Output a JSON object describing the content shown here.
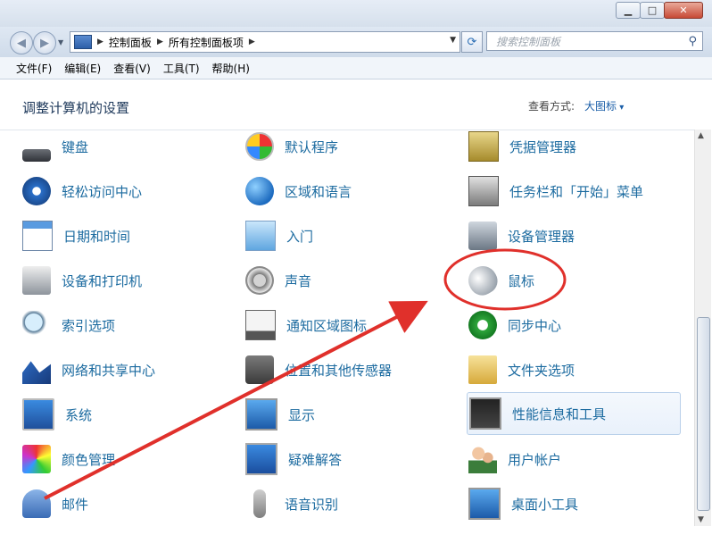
{
  "address": {
    "crumbs": [
      "控制面板",
      "所有控制面板项"
    ],
    "search_placeholder": "搜索控制面板"
  },
  "menu": [
    "文件(F)",
    "编辑(E)",
    "查看(V)",
    "工具(T)",
    "帮助(H)"
  ],
  "content": {
    "title": "调整计算机的设置",
    "view_by_label": "查看方式:",
    "view_by_value": "大图标"
  },
  "columns": [
    [
      "键盘",
      "轻松访问中心",
      "日期和时间",
      "设备和打印机",
      "索引选项",
      "网络和共享中心",
      "系统",
      "颜色管理",
      "邮件"
    ],
    [
      "默认程序",
      "区域和语言",
      "入门",
      "声音",
      "通知区域图标",
      "位置和其他传感器",
      "显示",
      "疑难解答",
      "语音识别"
    ],
    [
      "凭据管理器",
      "任务栏和「开始」菜单",
      "设备管理器",
      "鼠标",
      "同步中心",
      "文件夹选项",
      "性能信息和工具",
      "用户帐户",
      "桌面小工具"
    ]
  ],
  "highlighted_item": "性能信息和工具",
  "annotation_color": "#e0302b"
}
